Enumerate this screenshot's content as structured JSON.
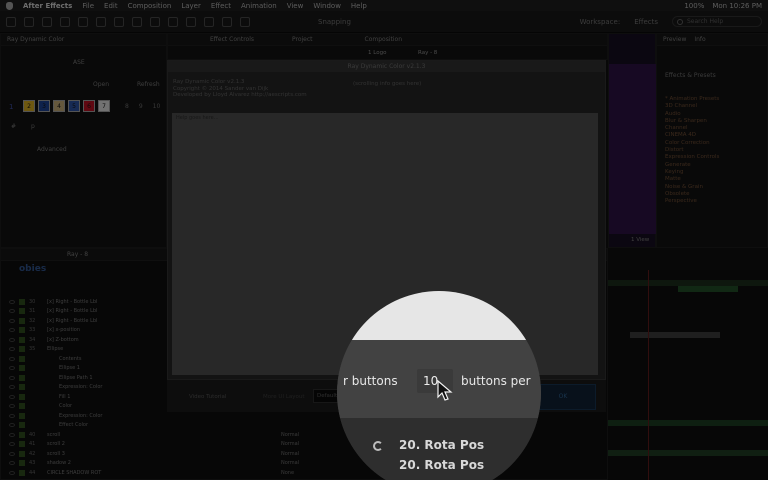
{
  "menubar": {
    "app": "After Effects",
    "items": [
      "File",
      "Edit",
      "Composition",
      "Layer",
      "Effect",
      "Animation",
      "View",
      "Window",
      "Help"
    ],
    "battery": "100%",
    "clock": "Mon 10:26 PM"
  },
  "toolbar": {
    "snapping": "Snapping",
    "workspace": "Workspace:",
    "workspace_value": "Effects",
    "search_placeholder": "Search Help"
  },
  "script_panel": {
    "title": "Ray Dynamic Color",
    "ase": "ASE",
    "open": "Open",
    "refresh": "Refresh",
    "row_number": "1",
    "swatches": [
      "2",
      "3",
      "4",
      "5",
      "6",
      "7"
    ],
    "swatch_colors": [
      "#c8a020",
      "#1d3f8a",
      "#b8a070",
      "#2a4d9a",
      "#b01020",
      "#d0d0d0"
    ],
    "extra_numbers": [
      "8",
      "9",
      "10"
    ],
    "hash": "#",
    "p": "p",
    "advanced": "Advanced"
  },
  "effect_controls": {
    "tab": "Effect Controls",
    "project": "Project",
    "composition": "Composition",
    "layer_label": "1 Logo",
    "ray_label": "Ray - 8"
  },
  "dialog": {
    "title": "Ray Dynamic Color v2.1.3",
    "info_lines": [
      "Ray Dynamic Color v2.1.3",
      "Copyright © 2014 Sander van Dijk",
      "Developed by Lloyd Alvarez http://aescripts.com"
    ],
    "info_right": "(scrolling info goes here)",
    "help_text": "Help goes here...",
    "video_tutorial": "Video Tutorial",
    "more_ui_layout": "More UI Layout",
    "layout_value": "Default",
    "ok": "OK"
  },
  "magnifier": {
    "buttons_label": "r buttons",
    "buttons_value": "10",
    "buttons_per_label": "buttons per",
    "row1": "20. Rota Pos",
    "row2": "20. Rota Pos"
  },
  "timeline": {
    "tab": "Ray - 8",
    "comp_name": "obies",
    "layers": [
      {
        "num": "30",
        "name": "[x] Right - Bottle Lbl"
      },
      {
        "num": "31",
        "name": "[x] Right - Bottle Lbl"
      },
      {
        "num": "32",
        "name": "[x] Right - Bottle Lbl"
      },
      {
        "num": "33",
        "name": "[x] x-position"
      },
      {
        "num": "34",
        "name": "[x] Z-bottom"
      },
      {
        "num": "35",
        "name": "Ellipse"
      },
      {
        "num": "",
        "name": "Contents"
      },
      {
        "num": "",
        "name": "Ellipse 1"
      },
      {
        "num": "",
        "name": "Ellipse Path 1"
      },
      {
        "num": "",
        "name": "Expression: Color"
      },
      {
        "num": "",
        "name": "Fill 1"
      },
      {
        "num": "",
        "name": "Color"
      },
      {
        "num": "",
        "name": "Expression: Color"
      },
      {
        "num": "",
        "name": "Effect Color"
      },
      {
        "num": "40",
        "name": "scroll"
      },
      {
        "num": "41",
        "name": "scroll 2"
      },
      {
        "num": "42",
        "name": "scroll 3"
      },
      {
        "num": "43",
        "name": "shadow 2"
      },
      {
        "num": "44",
        "name": "CIRCLE SHADOW ROT"
      }
    ],
    "modes": [
      "Normal",
      "Normal",
      "Normal",
      "Normal",
      "None"
    ]
  },
  "effects_panel": {
    "tabs": [
      "Preview",
      "Info"
    ],
    "title": "Effects & Presets",
    "items": [
      "* Animation Presets",
      "3D Channel",
      "Audio",
      "Blur & Sharpen",
      "Channel",
      "CINEMA 4D",
      "Color Correction",
      "Distort",
      "Expression Controls",
      "Generate",
      "Keying",
      "Matte",
      "Noise & Grain",
      "Obsolete",
      "Perspective"
    ]
  },
  "comp_view": {
    "view_label": "1 View"
  }
}
